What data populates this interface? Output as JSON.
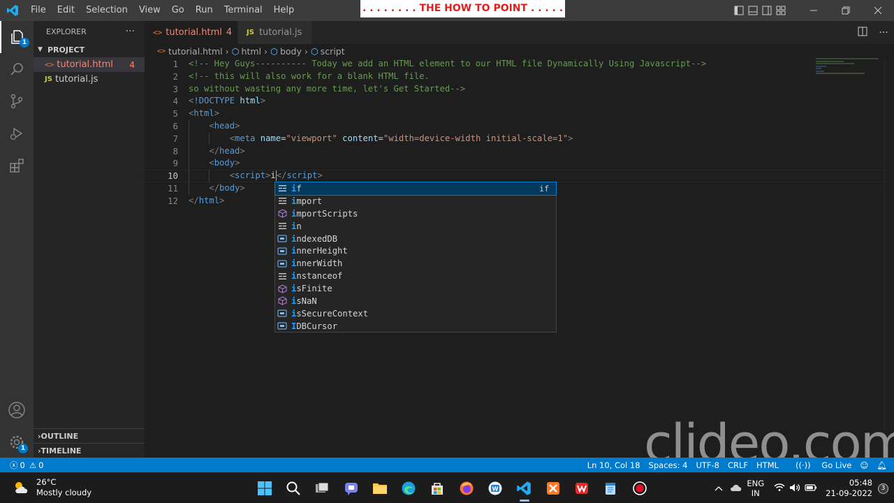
{
  "titlebar": {
    "menu": [
      "File",
      "Edit",
      "Selection",
      "View",
      "Go",
      "Run",
      "Terminal",
      "Help"
    ],
    "banner": ". . . . . . . . THE HOW TO POINT . . . . . . . . ."
  },
  "activitybar": {
    "explorer_badge": "1",
    "manage_badge": "1"
  },
  "sidebar": {
    "title": "EXPLORER",
    "more": "···",
    "project": "PROJECT",
    "files": [
      {
        "name": "tutorial.html",
        "icon": "html-file-icon",
        "badge": "4"
      },
      {
        "name": "tutorial.js",
        "icon": "js-file-icon",
        "badge": ""
      }
    ],
    "outline": "OUTLINE",
    "timeline": "TIMELINE"
  },
  "tabs": [
    {
      "label": "tutorial.html",
      "problems": "4",
      "icon_text": "<>"
    },
    {
      "label": "tutorial.js",
      "icon_text": "JS"
    }
  ],
  "breadcrumb": [
    "tutorial.html",
    "html",
    "body",
    "script"
  ],
  "editor": {
    "line_numbers": [
      "1",
      "2",
      "3",
      "4",
      "5",
      "6",
      "7",
      "8",
      "9",
      "10",
      "11",
      "12"
    ],
    "current_line": "10",
    "lines": {
      "l1": "<!-- Hey Guys---------- Today we add an HTML element to our HTML file Dynamically Using Javascript-->",
      "l2": "<!-- this will also work for a blank HTML file.",
      "l3": "so without wasting any more time, let's Get Started-->",
      "l4_doctype": "!DOCTYPE",
      "l4_html": "html",
      "tag_html": "html",
      "tag_head": "head",
      "tag_meta": "meta",
      "attr_name": "name",
      "val_name": "\"viewport\"",
      "attr_content": "content",
      "val_content": "\"width=device-width initial-scale=1\"",
      "tag_body": "body",
      "tag_script": "script",
      "typed": "i"
    }
  },
  "suggest": {
    "items": [
      {
        "match": "i",
        "rest": "f",
        "kind": "keyword",
        "detail": "if"
      },
      {
        "match": "i",
        "rest": "mport",
        "kind": "keyword",
        "detail": ""
      },
      {
        "match": "i",
        "rest": "mportScripts",
        "kind": "method",
        "detail": ""
      },
      {
        "match": "i",
        "rest": "n",
        "kind": "keyword",
        "detail": ""
      },
      {
        "match": "i",
        "rest": "ndexedDB",
        "kind": "variable",
        "detail": ""
      },
      {
        "match": "i",
        "rest": "nnerHeight",
        "kind": "variable",
        "detail": ""
      },
      {
        "match": "i",
        "rest": "nnerWidth",
        "kind": "variable",
        "detail": ""
      },
      {
        "match": "i",
        "rest": "nstanceof",
        "kind": "keyword",
        "detail": ""
      },
      {
        "match": "i",
        "rest": "sFinite",
        "kind": "method",
        "detail": ""
      },
      {
        "match": "i",
        "rest": "sNaN",
        "kind": "method",
        "detail": ""
      },
      {
        "match": "i",
        "rest": "sSecureContext",
        "kind": "variable",
        "detail": ""
      },
      {
        "match": "I",
        "rest": "DBCursor",
        "kind": "variable",
        "detail": ""
      }
    ]
  },
  "statusbar": {
    "errors": "0",
    "warnings": "0",
    "position": "Ln 10, Col 18",
    "spaces": "Spaces: 4",
    "encoding": "UTF-8",
    "eol": "CRLF",
    "language": "HTML",
    "golive": "Go Live"
  },
  "watermark": "clideo.com",
  "taskbar": {
    "temperature": "26°C",
    "weather": "Mostly cloudy",
    "lang_top": "ENG",
    "lang_bottom": "IN",
    "time": "05:48",
    "date": "21-09-2022",
    "notifications": "3"
  },
  "colors": {
    "accent": "#007acc",
    "comment": "#6a9955",
    "tag": "#569cd6",
    "attribute": "#9cdcfe",
    "string": "#ce9178",
    "error": "#f48771"
  }
}
